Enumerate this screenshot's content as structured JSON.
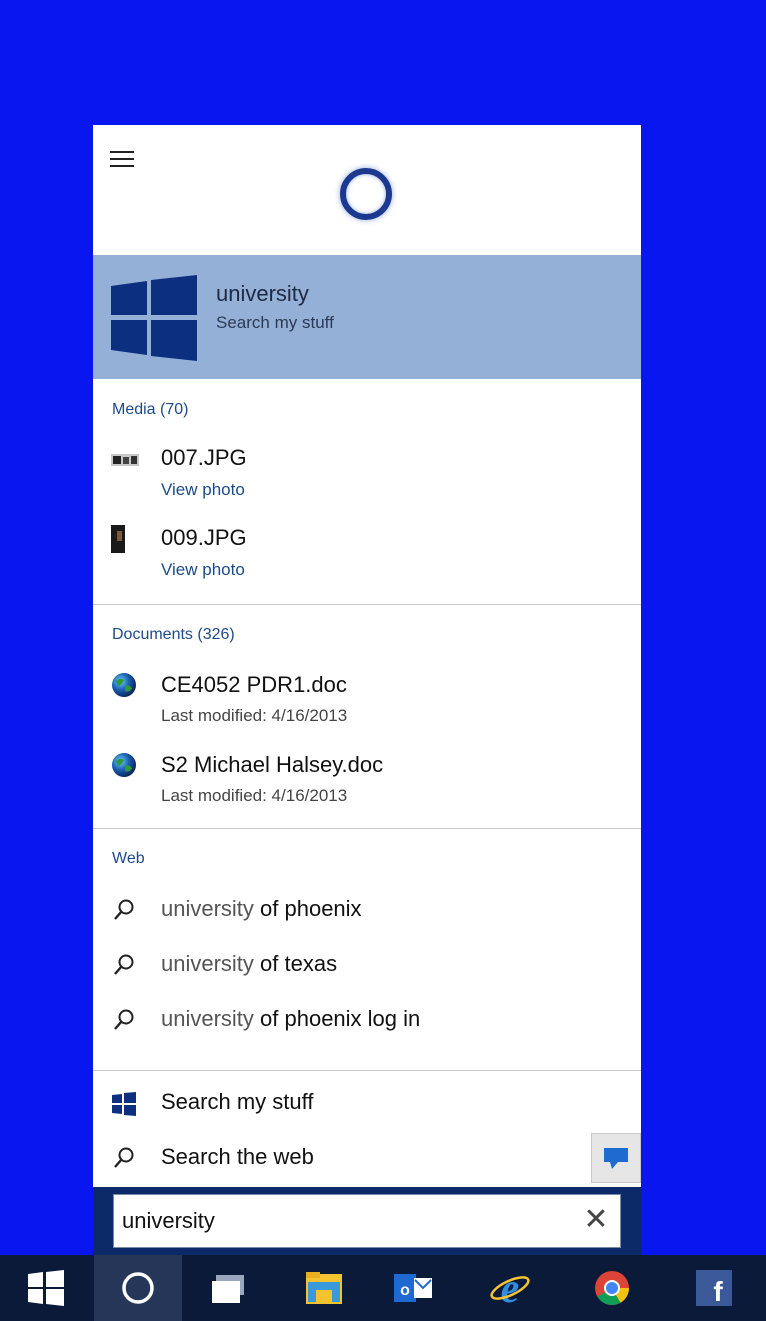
{
  "best_match": {
    "title": "university",
    "subtitle": "Search my stuff"
  },
  "media": {
    "header": "Media (70)",
    "items": [
      {
        "name": "007.JPG",
        "action": "View photo"
      },
      {
        "name": "009.JPG",
        "action": "View photo"
      }
    ]
  },
  "documents": {
    "header": "Documents (326)",
    "items": [
      {
        "name": "CE4052 PDR1.doc",
        "meta": "Last modified: 4/16/2013"
      },
      {
        "name": "S2 Michael Halsey.doc",
        "meta": "Last modified: 4/16/2013"
      }
    ]
  },
  "web": {
    "header": "Web",
    "suggestions": [
      {
        "prefix": "university",
        "rest": " of phoenix"
      },
      {
        "prefix": "university",
        "rest": " of texas"
      },
      {
        "prefix": "university",
        "rest": " of phoenix log in"
      }
    ]
  },
  "bottom_actions": {
    "search_my_stuff": "Search my stuff",
    "search_the_web": "Search the web"
  },
  "search": {
    "value": "university"
  },
  "taskbar": {
    "items": [
      "start-icon",
      "cortana-icon",
      "task-view-icon",
      "file-explorer-icon",
      "outlook-icon",
      "internet-explorer-icon",
      "chrome-icon",
      "facebook-icon"
    ],
    "facebook_letter": "f",
    "outlook_letter": "o"
  },
  "colors": {
    "desktop": "#0a16f0",
    "best_match_bg": "#94b0d6",
    "section_header": "#1e4a8c",
    "taskbar": "#0c1a3a",
    "searchbar": "#0c2a68"
  }
}
